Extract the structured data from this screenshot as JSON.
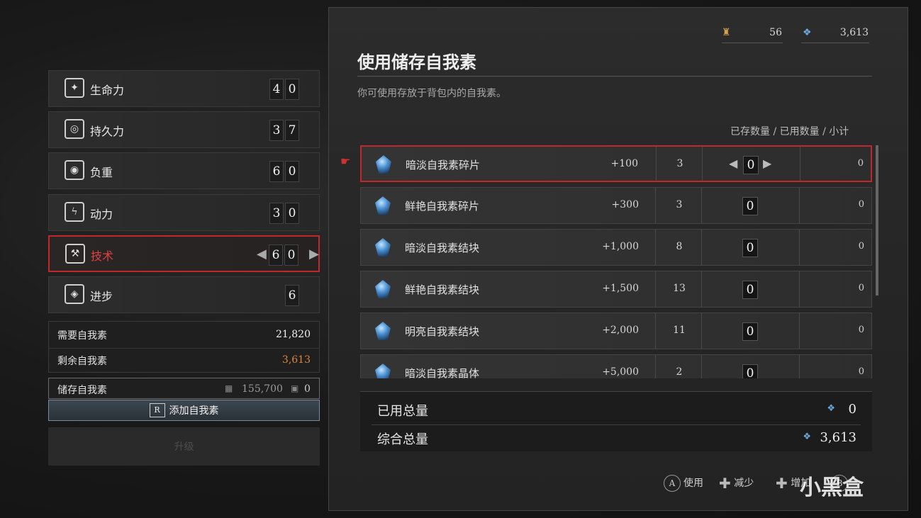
{
  "currency": {
    "item_count": "56",
    "ergo": "3,613",
    "item_icon": "pouch-icon",
    "ergo_icon": "ergo-icon"
  },
  "stats": [
    {
      "label": "生命力",
      "d1": "4",
      "d2": "0",
      "icon": "vitality-icon"
    },
    {
      "label": "持久力",
      "d1": "3",
      "d2": "7",
      "icon": "endurance-icon"
    },
    {
      "label": "负重",
      "d1": "6",
      "d2": "0",
      "icon": "capacity-icon"
    },
    {
      "label": "动力",
      "d1": "3",
      "d2": "0",
      "icon": "motivity-icon"
    },
    {
      "label": "技术",
      "d1": "6",
      "d2": "0",
      "icon": "technique-icon"
    },
    {
      "label": "进步",
      "d1": "",
      "d2": "6",
      "icon": "advance-icon"
    }
  ],
  "required": {
    "label": "需要自我素",
    "value": "21,820"
  },
  "remaining": {
    "label": "剩余自我素",
    "value": "3,613"
  },
  "stored": {
    "label": "储存自我素",
    "amount": "155,700",
    "count": "0"
  },
  "add_button": "添加自我素",
  "add_button_key": "R",
  "upgrade_button": "升级",
  "panel": {
    "title": "使用储存自我素",
    "desc": "你可使用存放于背包内的自我素。",
    "columns": "已存数量 / 已用数量 / 小计"
  },
  "items": [
    {
      "name": "暗淡自我素碎片",
      "bonus": "+100",
      "stored": "3",
      "used": "0",
      "subtotal": "0"
    },
    {
      "name": "鲜艳自我素碎片",
      "bonus": "+300",
      "stored": "3",
      "used": "0",
      "subtotal": "0"
    },
    {
      "name": "暗淡自我素结块",
      "bonus": "+1,000",
      "stored": "8",
      "used": "0",
      "subtotal": "0"
    },
    {
      "name": "鲜艳自我素结块",
      "bonus": "+1,500",
      "stored": "13",
      "used": "0",
      "subtotal": "0"
    },
    {
      "name": "明亮自我素结块",
      "bonus": "+2,000",
      "stored": "11",
      "used": "0",
      "subtotal": "0"
    },
    {
      "name": "暗淡自我素晶体",
      "bonus": "+5,000",
      "stored": "2",
      "used": "0",
      "subtotal": "0"
    }
  ],
  "totals": {
    "used_label": "已用总量",
    "used_value": "0",
    "combined_label": "综合总量",
    "combined_value": "3,613"
  },
  "controls": {
    "use_key": "A",
    "use_label": "使用",
    "decrease_label": "减少",
    "increase_label": "增加",
    "back_key": "B"
  },
  "watermark": "小黑盒",
  "colors": {
    "selection": "#c0282b",
    "remaining_value": "#e0843a",
    "accent_gem": "#4b8fd0"
  }
}
